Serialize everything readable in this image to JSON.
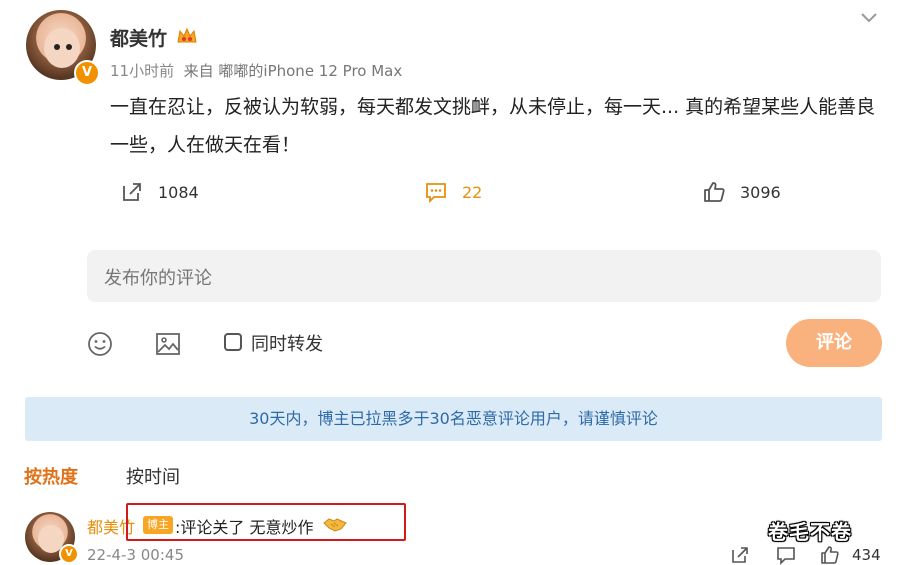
{
  "post": {
    "username": "都美竹",
    "time": "11小时前",
    "source": "来自 嘟嘟的iPhone 12 Pro Max",
    "text": "一直在忍让，反被认为软弱，每天都发文挑衅，从未停止，每一天... 真的希望某些人能善良一些，人在做天在看！",
    "verified_badge": "V"
  },
  "actions": {
    "repost_count": "1084",
    "comment_count": "22",
    "like_count": "3096"
  },
  "composer": {
    "placeholder": "发布你的评论",
    "repost_checkbox_label": "同时转发",
    "submit_label": "评论"
  },
  "notice": {
    "text": "30天内，博主已拉黑多于30名恶意评论用户，请谨慎评论"
  },
  "sort": {
    "hot_label": "按热度",
    "time_label": "按时间"
  },
  "comment": {
    "username": "都美竹",
    "tag": "博主",
    "text": ":评论关了 无意炒作",
    "date": "22-4-3 00:45",
    "like_count": "434",
    "verified_badge": "V"
  },
  "watermark": "卷毛不卷",
  "colors": {
    "accent_orange": "#e5900f",
    "submit_bg": "#f9b27d",
    "notice_bg": "#dbeaf7",
    "notice_text": "#2e6aa8",
    "highlight_box": "#d21a1a"
  }
}
